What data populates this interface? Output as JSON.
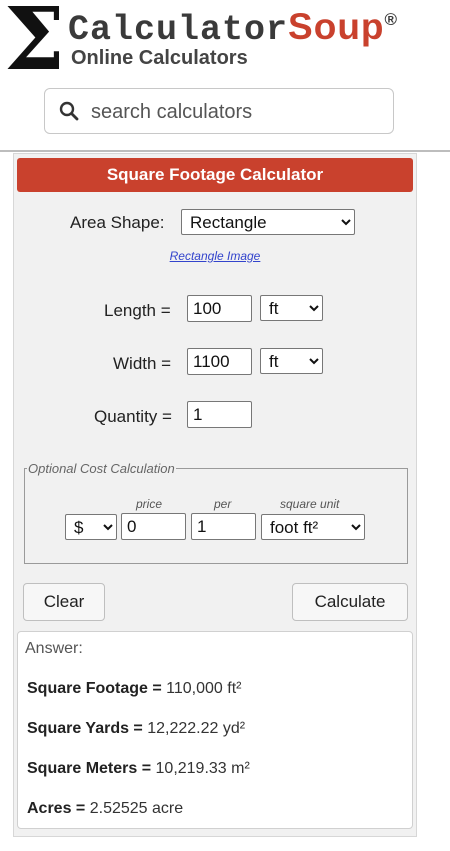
{
  "header": {
    "logo_sigma": "Σ",
    "logo_name_1": "Calculator",
    "logo_name_2": "Soup",
    "logo_reg": "®",
    "logo_tagline": "Online Calculators",
    "search_placeholder": "search calculators",
    "search_icon": "search-icon"
  },
  "calculator": {
    "title": "Square Footage Calculator",
    "area_shape_label": "Area Shape:",
    "area_shape_value": "Rectangle",
    "image_link": "Rectangle Image",
    "length_label": "Length =",
    "length_value": "100",
    "length_unit": "ft",
    "width_label": "Width =",
    "width_value": "1100",
    "width_unit": "ft",
    "quantity_label": "Quantity =",
    "quantity_value": "1",
    "optional": {
      "legend": "Optional Cost Calculation",
      "currency": "$",
      "price_label": "price",
      "price_value": "0",
      "per_label": "per",
      "per_value": "1",
      "unit_label": "square unit",
      "unit_value": "foot ft²"
    },
    "clear_label": "Clear",
    "calculate_label": "Calculate"
  },
  "answer": {
    "heading": "Answer:",
    "lines": [
      {
        "label": "Square Footage =",
        "value": "110,000 ft²"
      },
      {
        "label": "Square Yards =",
        "value": "12,222.22 yd²"
      },
      {
        "label": "Square Meters =",
        "value": "10,219.33 m²"
      },
      {
        "label": "Acres =",
        "value": "2.52525 acre"
      }
    ]
  },
  "colors": {
    "brand_red": "#c9412d",
    "link_blue": "#3344cc"
  }
}
